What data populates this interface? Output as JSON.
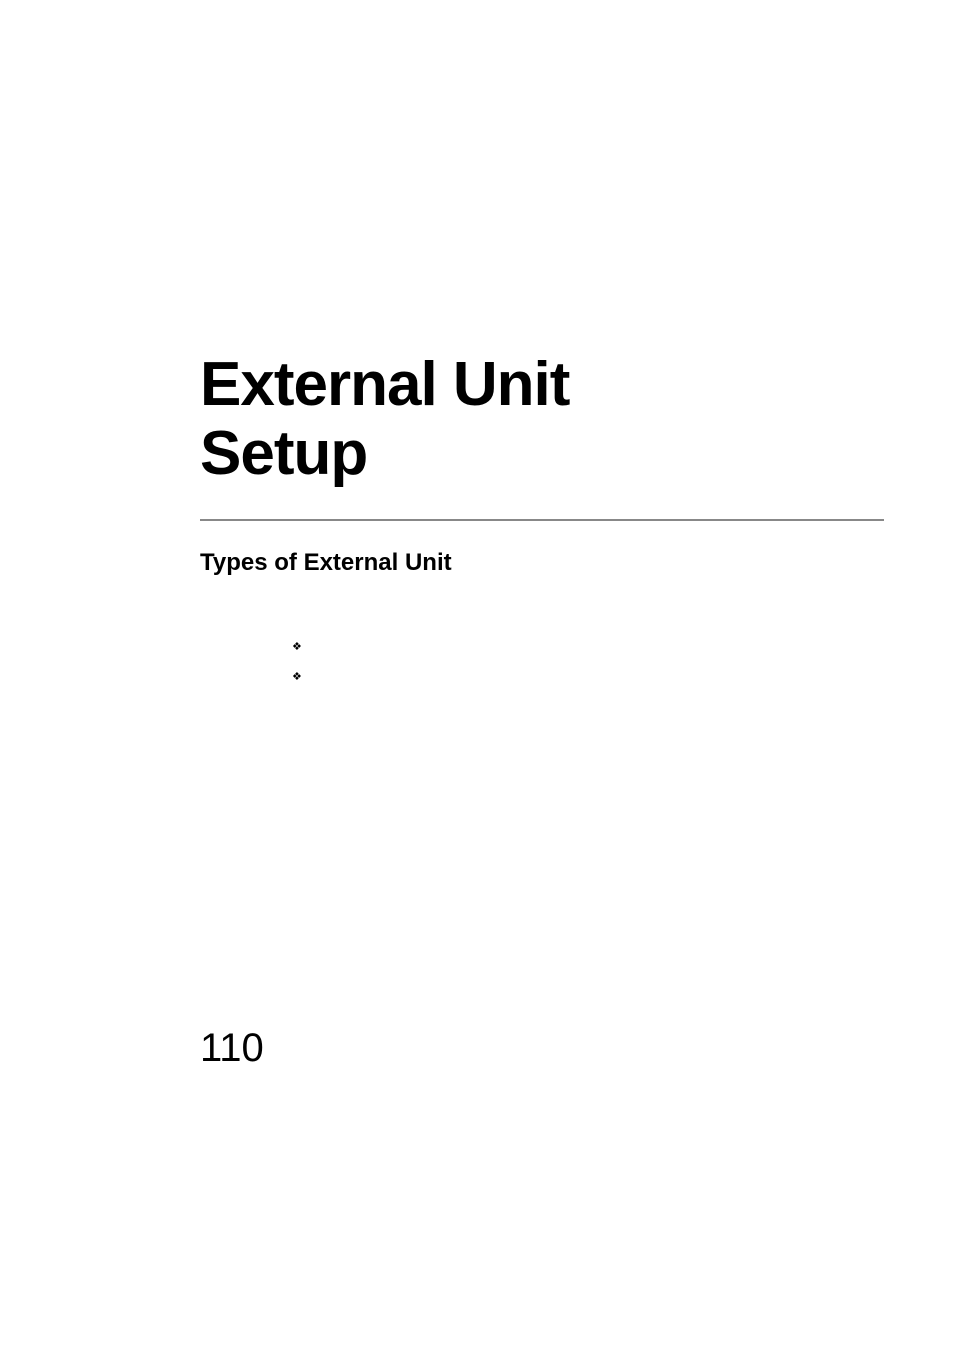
{
  "chapter": {
    "title_line1": "External Unit",
    "title_line2": "Setup"
  },
  "section": {
    "heading": "Types of External Unit"
  },
  "bullets": [
    {
      "icon": "❖"
    },
    {
      "icon": "❖"
    }
  ],
  "page_number": "110"
}
